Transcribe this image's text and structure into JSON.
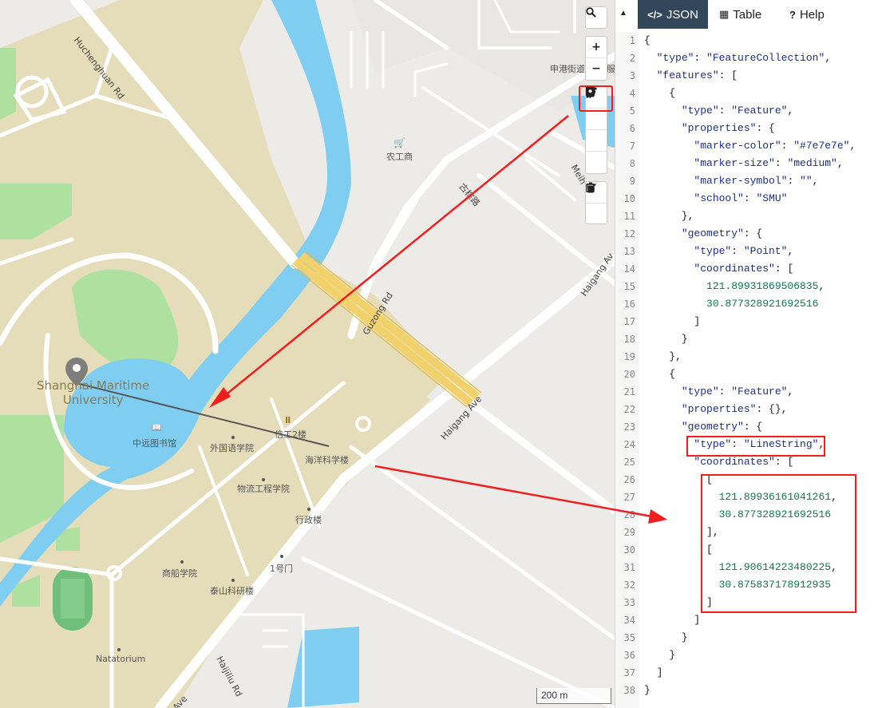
{
  "map": {
    "labels": {
      "huchenghuan": "Huchenghuan Rd",
      "shengang": "申港街道",
      "nonggong": "农工商",
      "gulanglu": "古棕路",
      "meihai": "Meih",
      "haigang_upper": "Haigang Av",
      "haigang_lower": "Haigang Ave",
      "guzong": "Guzong Rd",
      "university": "Shanghai Maritime\nUniversity",
      "library": "中远图书馆",
      "waiguoyu": "外国语学院",
      "xingong": "信工2楼",
      "haiyang": "海洋科学楼",
      "wuliu": "物流工程学院",
      "xingzheng": "行政楼",
      "yihaomen": "1号门",
      "shangchuan": "商船学院",
      "taishan": "泰山科研楼",
      "natatorium": "Natatorium",
      "haijiliu": "Haijiliu Rd",
      "ave_bottom": "Ave",
      "fu": "服"
    },
    "scale": "200 m",
    "controls": {
      "search": "search-icon",
      "zoom_in": "+",
      "zoom_out": "−",
      "tools": [
        "line-icon",
        "polygon-icon",
        "rectangle-icon",
        "marker-icon",
        "edit-icon",
        "trash-icon"
      ]
    }
  },
  "panel": {
    "tabs": [
      {
        "icon": "</>",
        "label": "JSON"
      },
      {
        "icon": "▦",
        "label": "Table"
      },
      {
        "icon": "?",
        "label": "Help"
      }
    ],
    "lines": [
      {
        "n": "1",
        "t": "{"
      },
      {
        "n": "2",
        "t": "  \"type\": \"FeatureCollection\","
      },
      {
        "n": "3",
        "t": "  \"features\": ["
      },
      {
        "n": "4",
        "t": "    {"
      },
      {
        "n": "5",
        "t": "      \"type\": \"Feature\","
      },
      {
        "n": "6",
        "t": "      \"properties\": {"
      },
      {
        "n": "7",
        "t": "        \"marker-color\": \"#7e7e7e\","
      },
      {
        "n": "8",
        "t": "        \"marker-size\": \"medium\","
      },
      {
        "n": "9",
        "t": "        \"marker-symbol\": \"\","
      },
      {
        "n": "10",
        "t": "        \"school\": \"SMU\""
      },
      {
        "n": "11",
        "t": "      },"
      },
      {
        "n": "12",
        "t": "      \"geometry\": {"
      },
      {
        "n": "13",
        "t": "        \"type\": \"Point\","
      },
      {
        "n": "14",
        "t": "        \"coordinates\": ["
      },
      {
        "n": "15",
        "t": "          121.89931869506835,"
      },
      {
        "n": "16",
        "t": "          30.877328921692516"
      },
      {
        "n": "17",
        "t": "        ]"
      },
      {
        "n": "18",
        "t": "      }"
      },
      {
        "n": "19",
        "t": "    },"
      },
      {
        "n": "20",
        "t": "    {"
      },
      {
        "n": "21",
        "t": "      \"type\": \"Feature\","
      },
      {
        "n": "22",
        "t": "      \"properties\": {},"
      },
      {
        "n": "23",
        "t": "      \"geometry\": {"
      },
      {
        "n": "24",
        "t": "        \"type\": \"LineString\","
      },
      {
        "n": "25",
        "t": "        \"coordinates\": ["
      },
      {
        "n": "26",
        "t": "          ["
      },
      {
        "n": "27",
        "t": "            121.89936161041261,"
      },
      {
        "n": "28",
        "t": "            30.877328921692516"
      },
      {
        "n": "29",
        "t": "          ],"
      },
      {
        "n": "30",
        "t": "          ["
      },
      {
        "n": "31",
        "t": "            121.90614223480225,"
      },
      {
        "n": "32",
        "t": "            30.875837178912935"
      },
      {
        "n": "33",
        "t": "          ]"
      },
      {
        "n": "34",
        "t": "        ]"
      },
      {
        "n": "35",
        "t": "      }"
      },
      {
        "n": "36",
        "t": "    }"
      },
      {
        "n": "37",
        "t": "  ]"
      },
      {
        "n": "38",
        "t": "}"
      }
    ]
  },
  "colors": {
    "tab_active": "#33475b",
    "annotation_red": "#f01e1e",
    "water": "#7fcdf0",
    "campus": "#e5ddb9",
    "park": "#aee0a0",
    "highway": "#f2d16b"
  }
}
